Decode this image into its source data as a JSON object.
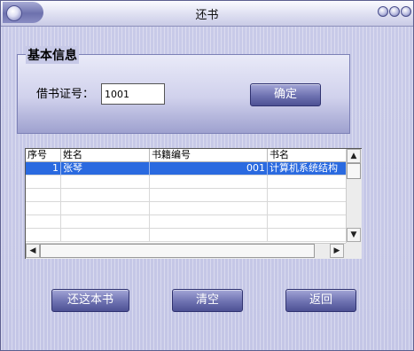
{
  "window": {
    "title": "还书"
  },
  "group": {
    "title": "基本信息",
    "card_label": "借书证号：",
    "card_value": "1001",
    "confirm_label": "确定"
  },
  "table": {
    "columns": [
      "序号",
      "姓名",
      "书籍编号",
      "书名"
    ],
    "rows": [
      {
        "seq": "1",
        "name": "张琴",
        "book_id": "001",
        "book_title": "计算机系统结构",
        "selected": true
      }
    ]
  },
  "actions": {
    "return_book": "还这本书",
    "clear": "清空",
    "back": "返回"
  },
  "colors": {
    "window_bg": "#c4c6e6",
    "button": "#6e72b1",
    "selection": "#2a6ae0"
  }
}
